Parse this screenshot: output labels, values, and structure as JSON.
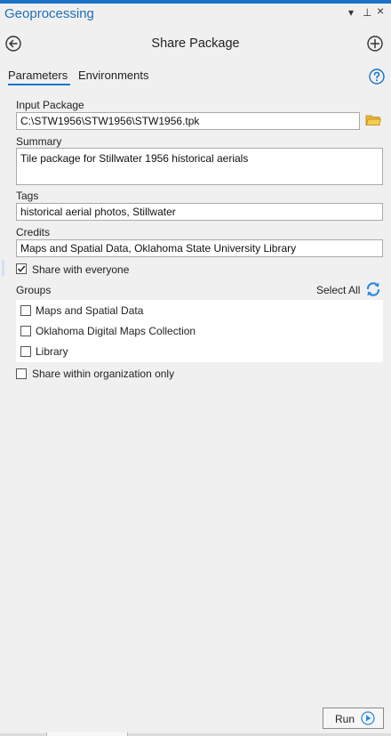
{
  "pane": {
    "title": "Geoprocessing",
    "controls": {
      "dropdown": "▾",
      "pin": "⊥",
      "close": "×"
    }
  },
  "tool": {
    "title": "Share Package"
  },
  "tabs": [
    {
      "label": "Parameters",
      "active": true
    },
    {
      "label": "Environments",
      "active": false
    }
  ],
  "params": {
    "input_package": {
      "label": "Input Package",
      "value": "C:\\STW1956\\STW1956\\STW1956.tpk"
    },
    "summary": {
      "label": "Summary",
      "value": "Tile package for Stillwater 1956 historical aerials"
    },
    "tags": {
      "label": "Tags",
      "value": "historical aerial photos, Stillwater"
    },
    "credits": {
      "label": "Credits",
      "value": "Maps and Spatial Data, Oklahoma State University Library"
    },
    "share_everyone": {
      "label": "Share with everyone",
      "checked": true
    },
    "groups": {
      "label": "Groups",
      "select_all": "Select All",
      "items": [
        {
          "label": "Maps and Spatial Data",
          "checked": false
        },
        {
          "label": "Oklahoma Digital Maps Collection",
          "checked": false
        },
        {
          "label": "Library",
          "checked": false
        }
      ]
    },
    "share_org": {
      "label": "Share within organization only",
      "checked": false
    }
  },
  "run": {
    "label": "Run"
  },
  "colors": {
    "accent": "#1a73c8",
    "folder": "#e8b62f",
    "background": "#f0f0f0"
  },
  "icons": {
    "back": "back-arrow-icon",
    "add": "plus-icon",
    "help": "help-icon",
    "folder": "folder-icon",
    "refresh": "refresh-icon",
    "run": "play-icon"
  }
}
